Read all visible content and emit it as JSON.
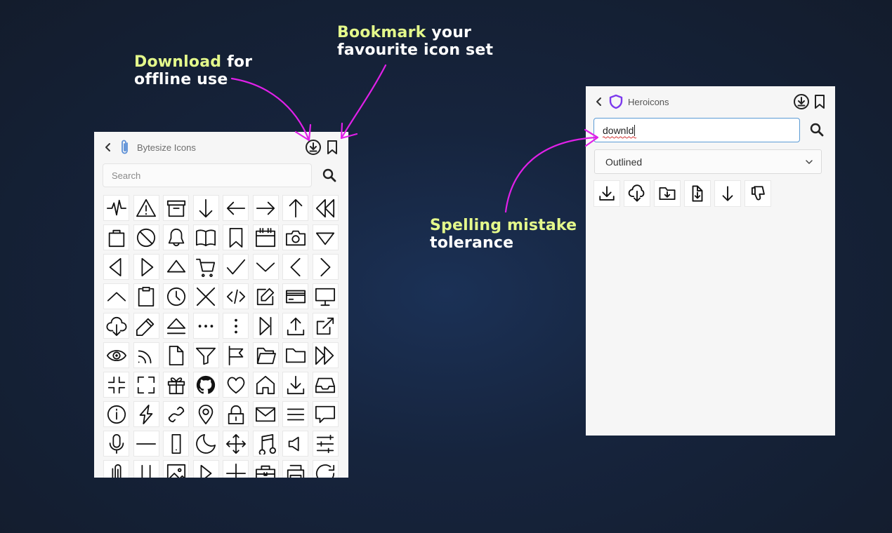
{
  "callouts": {
    "download": {
      "highlight": "Download",
      "rest1": " for",
      "line2": "offline use"
    },
    "bookmark": {
      "highlight": "Bookmark",
      "rest1": " your",
      "line2": "favourite icon set"
    },
    "spelling": {
      "highlight": "Spelling mistake",
      "line2": "tolerance"
    }
  },
  "colors": {
    "highlight": "#e4f98b",
    "arrow": "#e020e8",
    "heroicons_logo": "#7c3aed",
    "spell_underline": "#d32f2f"
  },
  "left_panel": {
    "back_icon": "chevron-left-icon",
    "logo_icon": "paperclip-icon",
    "title": "Bytesize Icons",
    "download_icon": "download-circle-icon",
    "bookmark_icon": "bookmark-icon",
    "search": {
      "placeholder": "Search",
      "icon": "search-icon"
    },
    "icons": [
      "activity",
      "alert",
      "archive",
      "arrow-bottom",
      "arrow-left",
      "arrow-right",
      "arrow-top",
      "backwards",
      "bag",
      "ban",
      "bell",
      "book",
      "bookmark",
      "calendar",
      "camera",
      "caret-bottom",
      "caret-left",
      "caret-right",
      "caret-top",
      "cart",
      "checkmark",
      "chevron-bottom",
      "chevron-left",
      "chevron-right",
      "chevron-top",
      "clipboard",
      "clock",
      "close",
      "code",
      "compose",
      "creditcard",
      "desktop",
      "download-cloud",
      "edit",
      "eject",
      "ellipsis-horizontal",
      "ellipsis-vertical",
      "end",
      "export",
      "external",
      "eye",
      "feed",
      "file",
      "filter",
      "flag",
      "folder-open",
      "folder",
      "forwards",
      "fullscreen-exit",
      "fullscreen",
      "gift",
      "github",
      "heart",
      "home",
      "import",
      "inbox",
      "info",
      "lightning",
      "link",
      "location",
      "lock",
      "mail",
      "menu",
      "message",
      "microphone",
      "minus",
      "mobile",
      "moon",
      "move",
      "music",
      "mute",
      "options",
      "paperclip",
      "pause",
      "photo",
      "play",
      "plus",
      "portfolio",
      "print",
      "reload"
    ]
  },
  "right_panel": {
    "back_icon": "chevron-left-icon",
    "logo_icon": "shield-icon",
    "title": "Heroicons",
    "download_icon": "download-circle-icon",
    "bookmark_icon": "bookmark-icon",
    "search": {
      "value": "downld",
      "icon": "search-icon"
    },
    "style_select": {
      "value": "Outlined",
      "icon": "chevron-down-icon"
    },
    "results": [
      "arrow-down-tray",
      "cloud-arrow-down",
      "folder-arrow-down",
      "document-arrow-down",
      "arrow-down",
      "hand-thumb-down"
    ]
  }
}
